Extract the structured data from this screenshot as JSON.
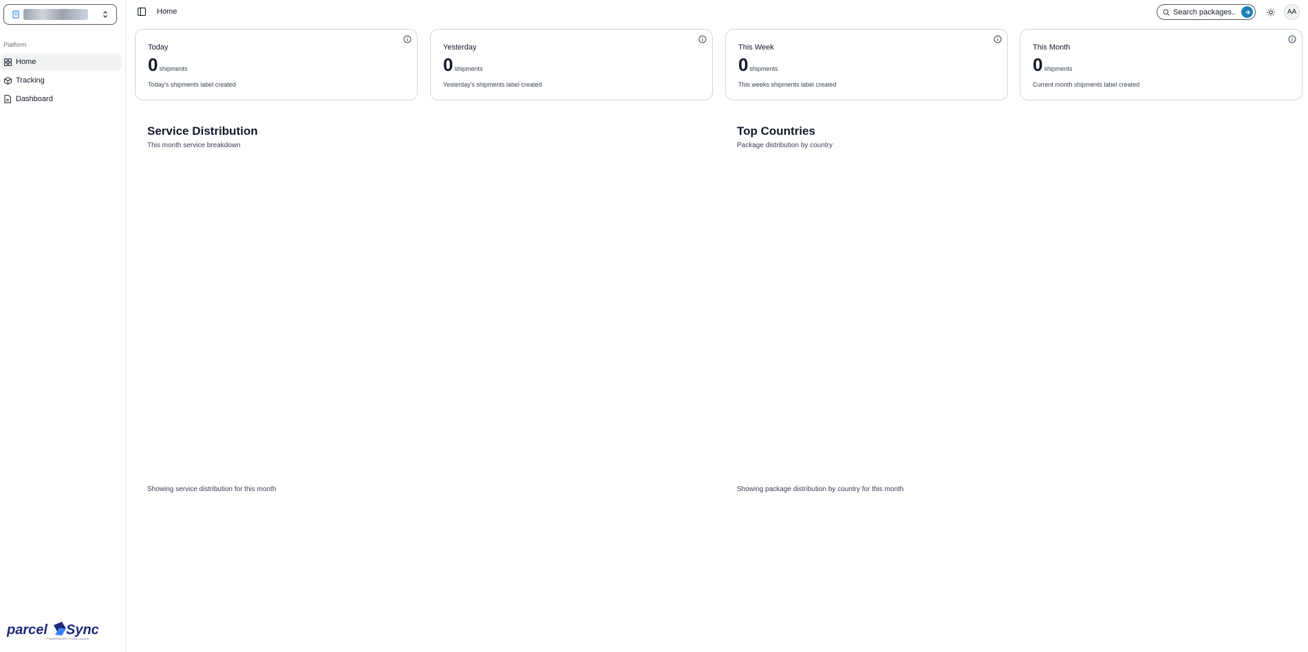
{
  "sidebar": {
    "group_label": "Platform",
    "items": [
      {
        "label": "Home",
        "icon": "layout-grid-icon",
        "active": true
      },
      {
        "label": "Tracking",
        "icon": "package-icon",
        "active": false
      },
      {
        "label": "Dashboard",
        "icon": "file-icon",
        "active": false
      }
    ],
    "logo_text": "parcelSync",
    "logo_tagline": "Powered By APC Priority Logistics"
  },
  "header": {
    "breadcrumb": "Home",
    "search_placeholder": "Search packages..",
    "avatar_initials": "AA"
  },
  "stats": [
    {
      "title": "Today",
      "value": "0",
      "unit": "shipments",
      "description": "Today's shipments label created"
    },
    {
      "title": "Yesterday",
      "value": "0",
      "unit": "shipments",
      "description": "Yesterday's shipments label created"
    },
    {
      "title": "This Week",
      "value": "0",
      "unit": "shipments",
      "description": "This weeks shipments label created"
    },
    {
      "title": "This Month",
      "value": "0",
      "unit": "shipments",
      "description": "Current month shipments label created"
    }
  ],
  "service_panel": {
    "title": "Service Distribution",
    "subtitle": "This month service breakdown",
    "footer": "Showing service distribution for this month"
  },
  "countries_panel": {
    "title": "Top Countries",
    "subtitle": "Package distribution by country",
    "footer": "Showing package distribution by country for this month"
  },
  "colors": {
    "accent": "#1f7fb8",
    "logo_blue": "#1e2a78",
    "border": "#d1d5db"
  }
}
